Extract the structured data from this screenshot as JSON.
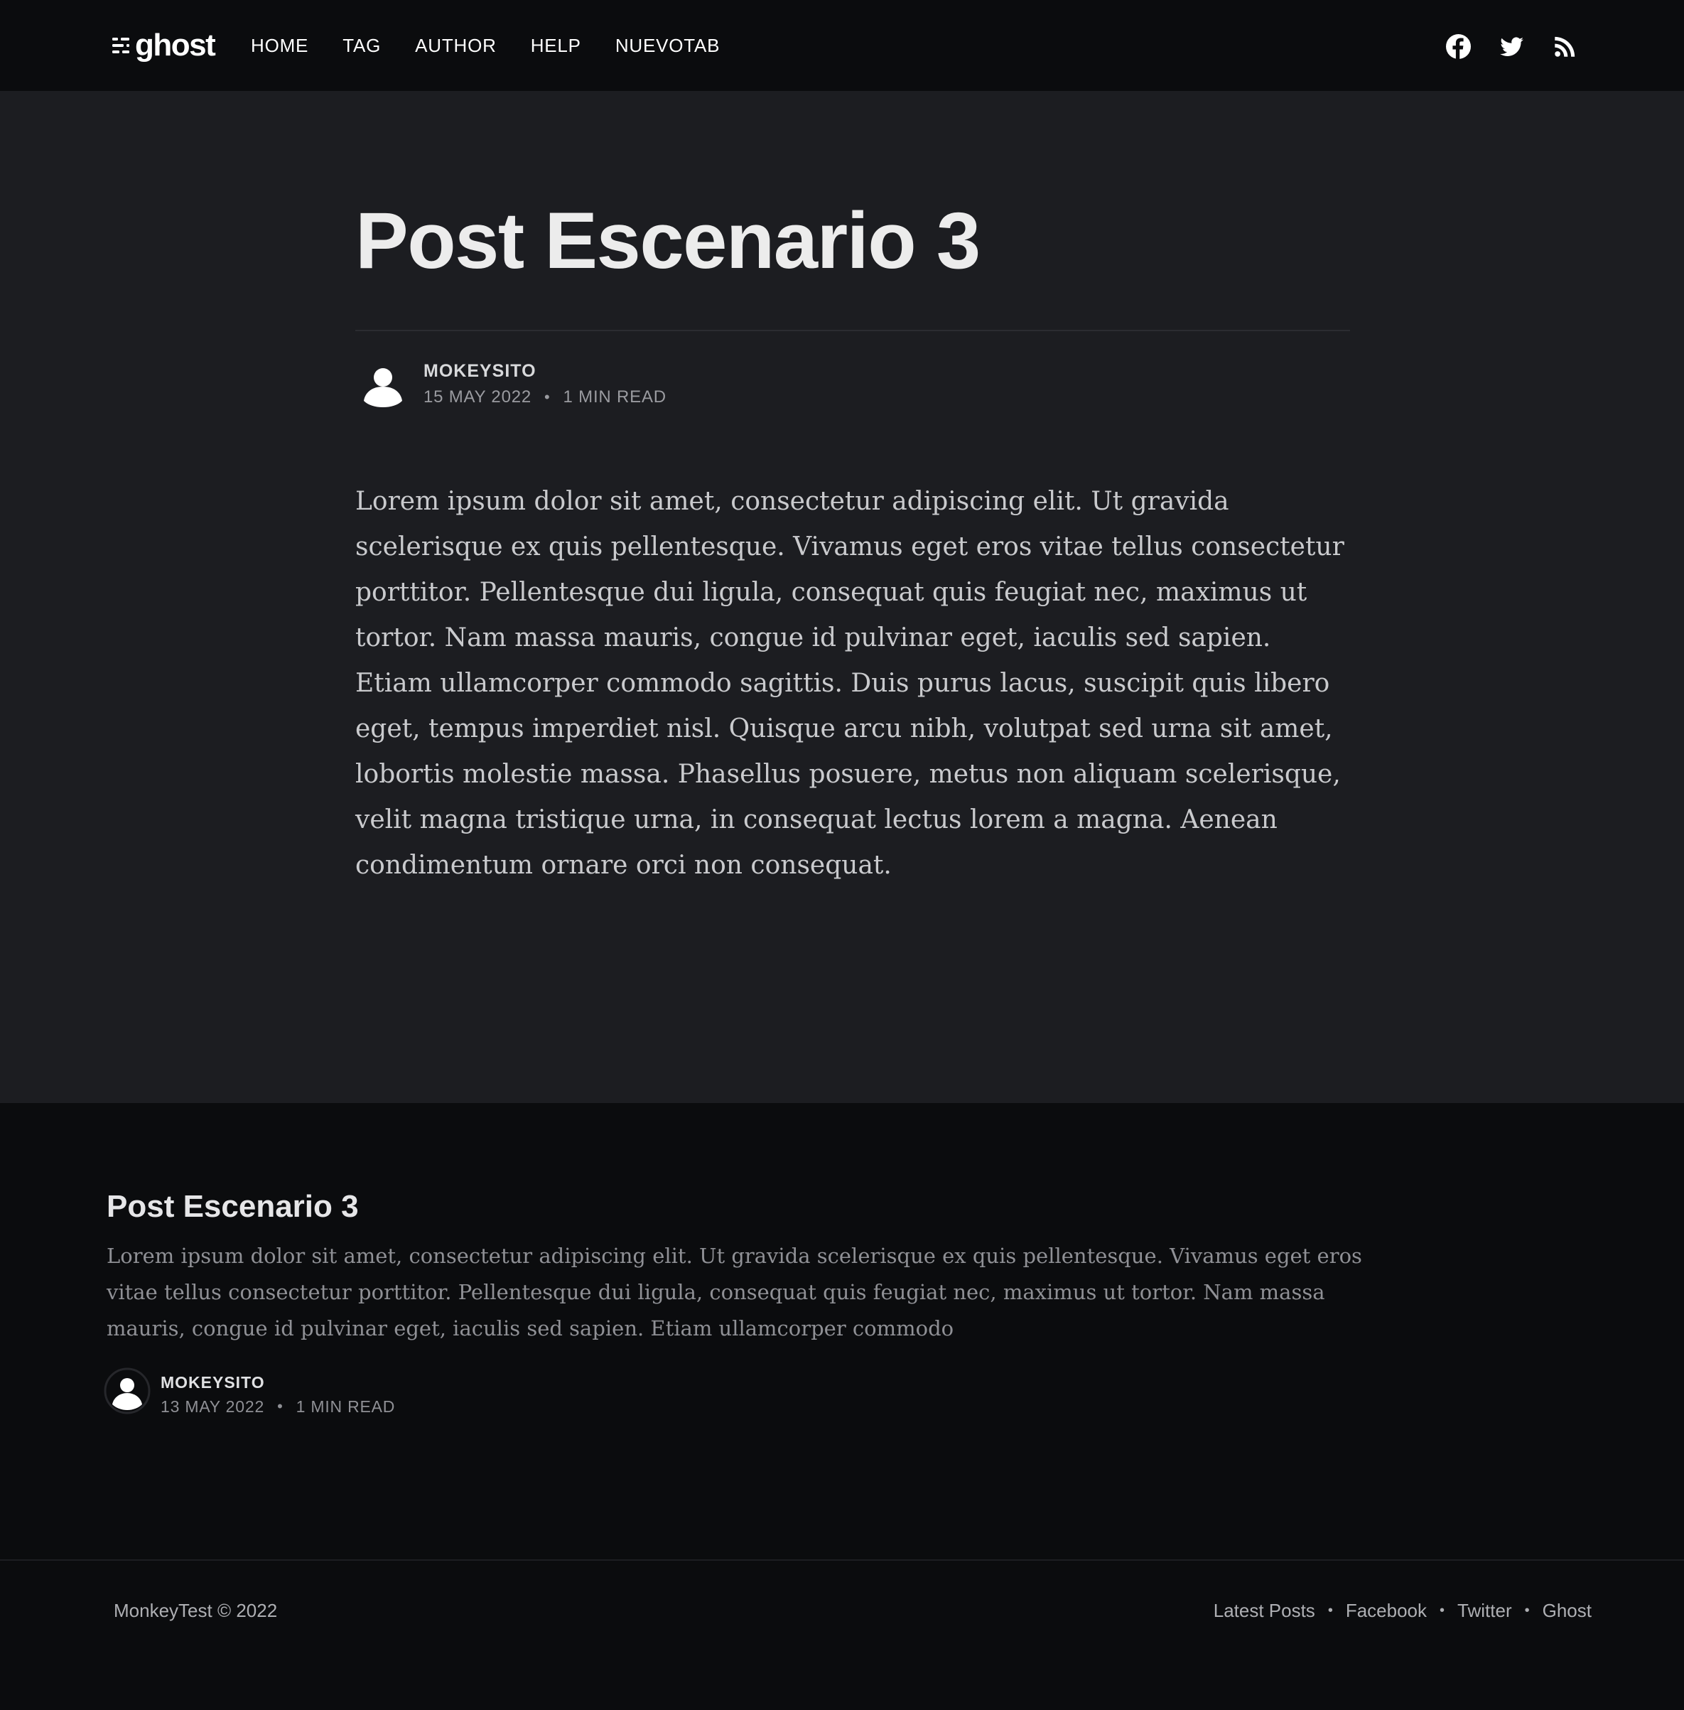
{
  "header": {
    "logo_text": "ghost",
    "nav": [
      "HOME",
      "TAG",
      "AUTHOR",
      "HELP",
      "NUEVOTAB"
    ],
    "social_icons": [
      "facebook-icon",
      "twitter-icon",
      "rss-icon"
    ]
  },
  "article": {
    "title": "Post Escenario 3",
    "author": "MOKEYSITO",
    "date": "15 MAY 2022",
    "separator": "•",
    "read_time": "1 MIN READ",
    "body": "Lorem ipsum dolor sit amet, consectetur adipiscing elit. Ut gravida scelerisque ex quis pellentesque. Vivamus eget eros vitae tellus consectetur porttitor. Pellentesque dui ligula, consequat quis feugiat nec, maximus ut tortor. Nam massa mauris, congue id pulvinar eget, iaculis sed sapien. Etiam ullamcorper commodo sagittis. Duis purus lacus, suscipit quis libero eget, tempus imperdiet nisl. Quisque arcu nibh, volutpat sed urna sit amet, lobortis molestie massa. Phasellus posuere, metus non aliquam scelerisque, velit magna tristique urna, in consequat lectus lorem a magna. Aenean condimentum ornare orci non consequat."
  },
  "related": {
    "title": "Post Escenario 3",
    "excerpt": "Lorem ipsum dolor sit amet, consectetur adipiscing elit. Ut gravida scelerisque ex quis pellentesque. Vivamus eget eros vitae tellus consectetur porttitor. Pellentesque dui ligula, consequat quis feugiat nec, maximus ut tortor. Nam massa mauris, congue id pulvinar eget, iaculis sed sapien. Etiam ullamcorper commodo",
    "author": "MOKEYSITO",
    "date": "13 MAY 2022",
    "separator": "•",
    "read_time": "1 MIN READ"
  },
  "footer": {
    "copyright": "MonkeyTest © 2022",
    "separator": "•",
    "links": [
      "Latest Posts",
      "Facebook",
      "Twitter",
      "Ghost"
    ]
  },
  "colors": {
    "header_bg": "#0b0c0e",
    "article_bg": "#1c1d21",
    "title_text": "#ececec",
    "body_text": "#c9cacd",
    "muted_text": "#8f9095"
  }
}
